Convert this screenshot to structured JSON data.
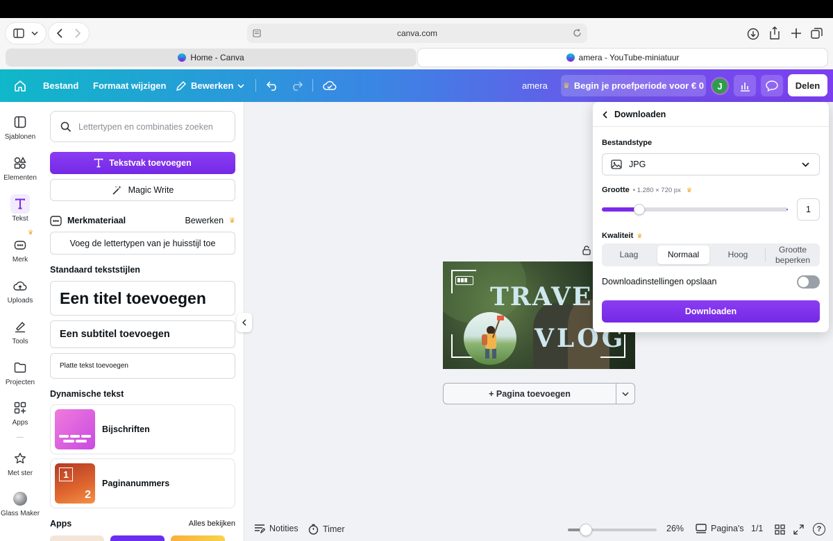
{
  "browser": {
    "address": "canva.com",
    "tabs": [
      {
        "label": "Home - Canva"
      },
      {
        "label": "amera - YouTube-miniatuur"
      }
    ]
  },
  "toolbar": {
    "file": "Bestand",
    "resize": "Formaat wijzigen",
    "edit": "Bewerken",
    "doc_title": "amera",
    "trial": "Begin je proefperiode voor € 0",
    "avatar_initial": "J",
    "share": "Delen"
  },
  "rail": {
    "items": [
      {
        "label": "Sjablonen",
        "icon": "templates-icon"
      },
      {
        "label": "Elementen",
        "icon": "elements-icon"
      },
      {
        "label": "Tekst",
        "icon": "text-icon"
      },
      {
        "label": "Merk",
        "icon": "brand-icon"
      },
      {
        "label": "Uploads",
        "icon": "upload-icon"
      },
      {
        "label": "Tools",
        "icon": "tools-icon"
      },
      {
        "label": "Projecten",
        "icon": "folder-icon"
      },
      {
        "label": "Apps",
        "icon": "apps-icon"
      },
      {
        "label": "Met ster",
        "icon": "star-icon"
      },
      {
        "label": "Glass Maker",
        "icon": "glass-maker-icon"
      }
    ]
  },
  "panel": {
    "search_placeholder": "Lettertypen en combinaties zoeken",
    "add_textbox": "Tekstvak toevoegen",
    "magic_write": "Magic Write",
    "brand_kit": "Merkmateriaal",
    "brand_edit": "Bewerken",
    "brand_fonts": "Voeg de lettertypen van je huisstijl toe",
    "default_styles": "Standaard tekststijlen",
    "heading": "Een titel toevoegen",
    "subheading": "Een subtitel toevoegen",
    "body": "Platte tekst toevoegen",
    "dynamic_text": "Dynamische tekst",
    "captions": "Bijschriften",
    "page_numbers": "Paginanummers",
    "page_numbers_thumb": [
      "1",
      "2"
    ],
    "apps": "Apps",
    "see_all": "Alles bekijken"
  },
  "canvas": {
    "design_text_1": "TRAVE",
    "design_text_2": "VLOG",
    "add_page": "+ Pagina toevoegen"
  },
  "download": {
    "title": "Downloaden",
    "file_type_label": "Bestandstype",
    "file_type": "JPG",
    "size_label": "Grootte",
    "size_value": "• 1.280 × 720 px",
    "size_multiplier": "1",
    "size_slider_fraction": 0.2,
    "quality_label": "Kwaliteit",
    "quality_options": [
      "Laag",
      "Normaal",
      "Hoog",
      "Grootte beperken"
    ],
    "quality_selected": "Normaal",
    "save_settings": "Downloadinstellingen opslaan",
    "save_settings_on": false,
    "download_button": "Downloaden"
  },
  "bottom": {
    "notes": "Notities",
    "timer": "Timer",
    "zoom": "26%",
    "zoom_slider_fraction": 0.2,
    "pages": "Pagina's",
    "page_count": "1/1"
  },
  "colors": {
    "accent_purple": "#7d2ae8",
    "canva_teal": "#00c4cc",
    "crown_gold": "#f5a623"
  }
}
